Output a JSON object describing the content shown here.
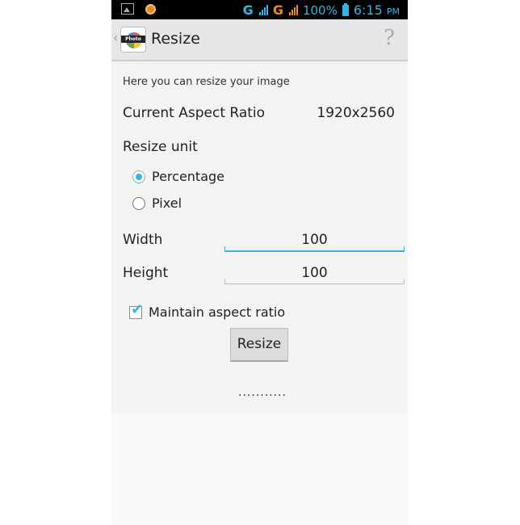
{
  "status_bar": {
    "network_1": "G",
    "network_2": "G",
    "battery": "100%",
    "time": "6:15",
    "ampm": "PM",
    "accent": "#33b5e5",
    "network_2_color": "#f08a1d"
  },
  "action_bar": {
    "up_caret": "‹",
    "app_icon_text": "Photo",
    "title": "Resize",
    "help_glyph": "?"
  },
  "content": {
    "intro": "Here you can resize your image",
    "aspect_ratio_label": "Current Aspect Ratio",
    "aspect_ratio_value": "1920x2560",
    "resize_unit_label": "Resize unit",
    "options": [
      {
        "label": "Percentage",
        "selected": true
      },
      {
        "label": "Pixel",
        "selected": false
      }
    ],
    "width_label": "Width",
    "width_value": "100",
    "height_label": "Height",
    "height_value": "100",
    "maintain_label": "Maintain aspect ratio",
    "maintain_checked": true,
    "resize_button": "Resize",
    "progress_text": "..........."
  }
}
